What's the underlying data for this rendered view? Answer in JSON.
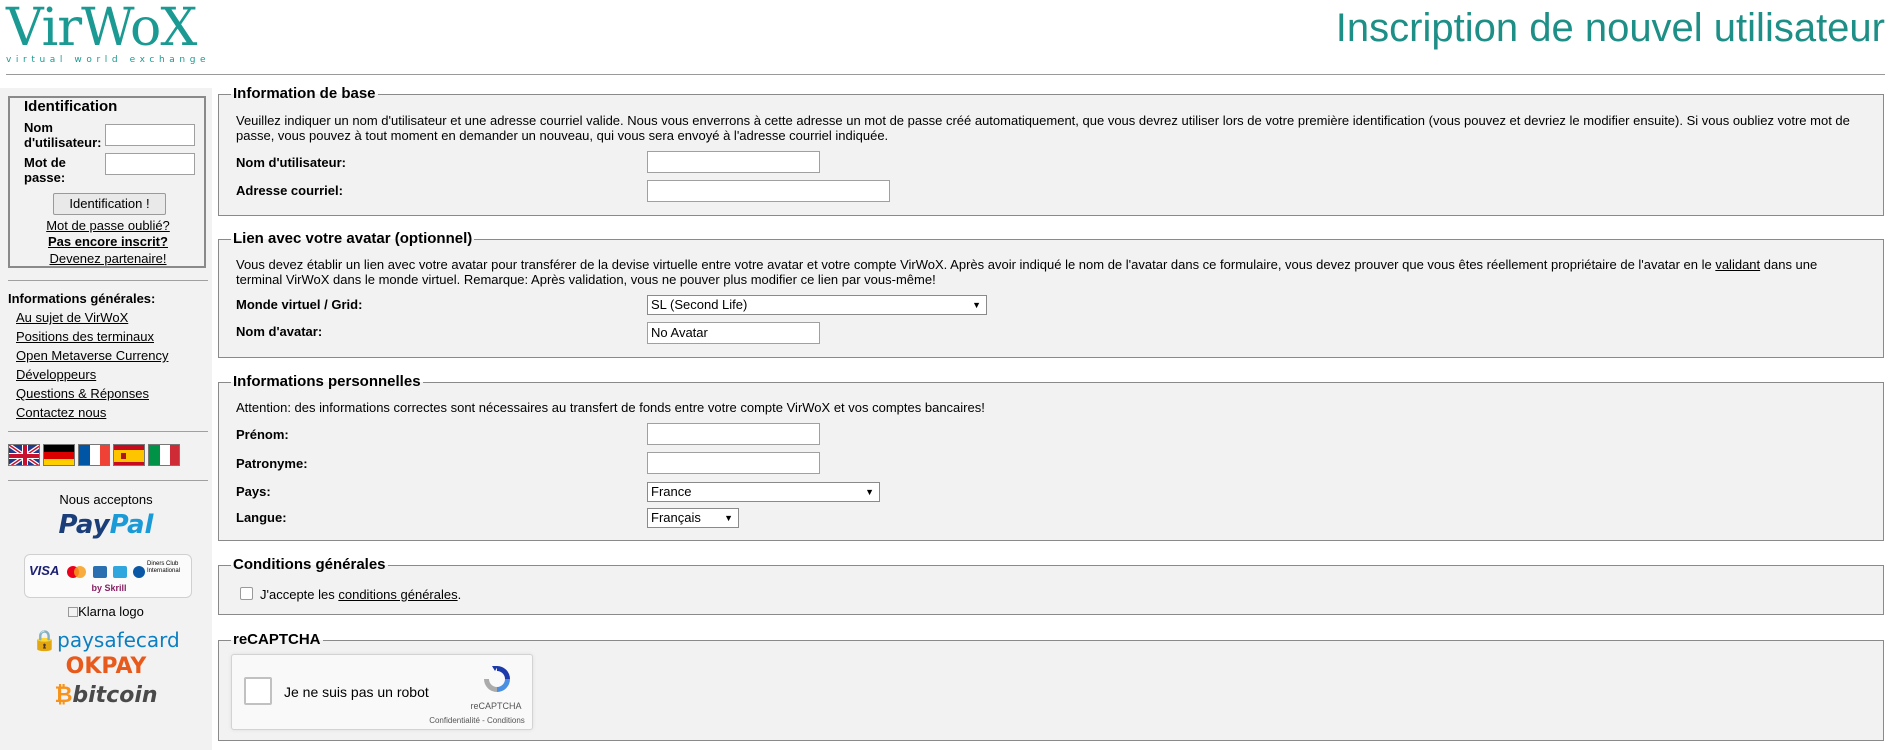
{
  "logo": {
    "name": "VirWoX",
    "tagline": "virtual world exchange"
  },
  "page_title": "Inscription de nouvel utilisateur",
  "login": {
    "legend": "Identification",
    "username_label_line1": "Nom",
    "username_label_line2": "d'utilisateur:",
    "password_label_line1": "Mot de",
    "password_label_line2": "passe:",
    "button": "Identification !",
    "forgot": "Mot de passe oublié?",
    "not_registered": "Pas encore inscrit?",
    "partner": "Devenez partenaire!"
  },
  "sidebar": {
    "info_heading": "Informations générales:",
    "links": [
      "Au sujet de VirWoX",
      "Positions des terminaux",
      "Open Metaverse Currency",
      "Développeurs",
      "Questions & Réponses",
      "Contactez nous"
    ],
    "flags": [
      "uk-flag",
      "german-flag",
      "french-flag",
      "spanish-flag",
      "italian-flag"
    ],
    "accept_label": "Nous acceptons",
    "paypal_a": "Pay",
    "paypal_b": "Pal",
    "skrill_by": "by Skrill",
    "card_visa": "VISA",
    "card_diners": "Diners Club International",
    "klarna_alt": "Klarna logo",
    "paysafe": "paysafecard",
    "okpay": "OKPAY",
    "bitcoin": "bitcoin"
  },
  "basic": {
    "legend": "Information de base",
    "text": "Veuillez indiquer un nom d'utilisateur et une adresse courriel valide. Nous vous enverrons à cette adresse un mot de passe créé automatiquement, que vous devrez utiliser lors de votre première identification (vous pouvez et devriez le modifier ensuite). Si vous oubliez votre mot de passe, vous pouvez à tout moment en demander un nouveau, qui vous sera envoyé à l'adresse courriel indiquée.",
    "username_label": "Nom d'utilisateur:",
    "email_label": "Adresse courriel:"
  },
  "avatar": {
    "legend": "Lien avec votre avatar (optionnel)",
    "text_a": "Vous devez établir un lien avec votre avatar pour transférer de la devise virtuelle entre votre avatar et votre compte VirWoX. Après avoir indiqué le nom de l'avatar dans ce formulaire, vous devez prouver que vous êtes réellement propriétaire de l'avatar en le ",
    "text_link": "validant",
    "text_b": " dans une terminal VirWoX dans le monde virtuel. Remarque: Après validation, vous ne pouver plus modifier ce lien par vous-même!",
    "world_label": "Monde virtuel / Grid:",
    "world_value": "SL (Second Life)",
    "avatar_label": "Nom d'avatar:",
    "avatar_value": "No Avatar"
  },
  "personal": {
    "legend": "Informations personnelles",
    "text": "Attention: des informations correctes sont nécessaires au transfert de fonds entre votre compte VirWoX et vos comptes bancaires!",
    "firstname_label": "Prénom:",
    "lastname_label": "Patronyme:",
    "country_label": "Pays:",
    "country_value": "France",
    "language_label": "Langue:",
    "language_value": "Français"
  },
  "terms": {
    "legend": "Conditions générales",
    "text_a": "J'accepte les ",
    "link": "conditions générales",
    "text_b": "."
  },
  "recaptcha": {
    "legend": "reCAPTCHA",
    "label": "Je ne suis pas un robot",
    "brand": "reCAPTCHA",
    "links": "Confidentialité - Conditions"
  }
}
